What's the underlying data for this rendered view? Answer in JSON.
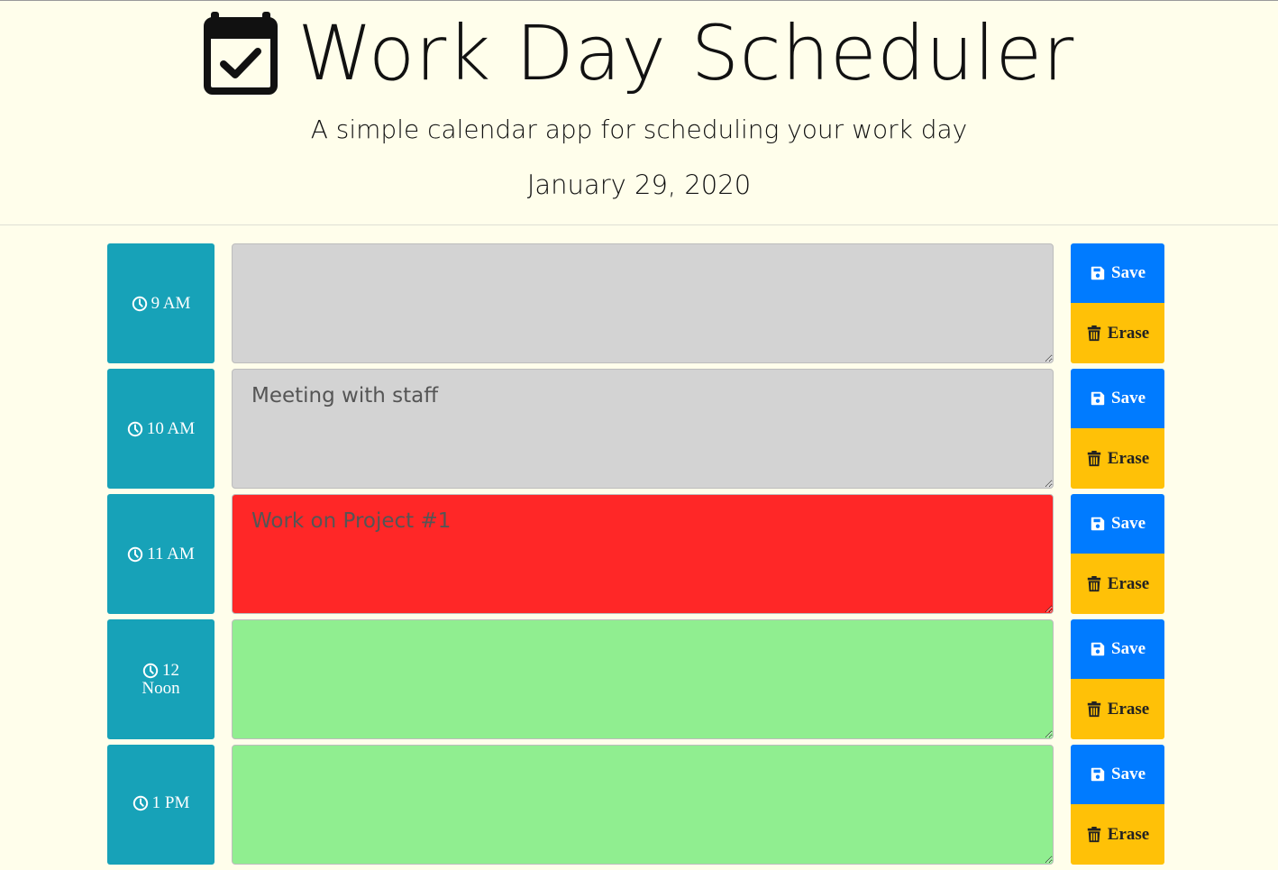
{
  "header": {
    "title": "Work Day Scheduler",
    "subtitle": "A simple calendar app for scheduling your work day",
    "date": "January 29, 2020",
    "icon": "calendar-check-icon"
  },
  "colors": {
    "background": "#fffeeb",
    "hour": "#17a2b8",
    "past": "#d3d3d3",
    "present": "#ff2727",
    "future": "#90ee90",
    "save": "#007bff",
    "erase": "#ffc107"
  },
  "rows": [
    {
      "hour_line1": "9 AM",
      "hour_line2": "",
      "task": "",
      "state": "past",
      "save_label": "Save",
      "erase_label": "Erase"
    },
    {
      "hour_line1": "10 AM",
      "hour_line2": "",
      "task": "Meeting with staff",
      "state": "past",
      "save_label": "Save",
      "erase_label": "Erase"
    },
    {
      "hour_line1": "11 AM",
      "hour_line2": "",
      "task": "Work on Project #1",
      "state": "present",
      "save_label": "Save",
      "erase_label": "Erase"
    },
    {
      "hour_line1": "12",
      "hour_line2": "Noon",
      "task": "",
      "state": "future",
      "save_label": "Save",
      "erase_label": "Erase"
    },
    {
      "hour_line1": "1 PM",
      "hour_line2": "",
      "task": "",
      "state": "future",
      "save_label": "Save",
      "erase_label": "Erase"
    }
  ]
}
